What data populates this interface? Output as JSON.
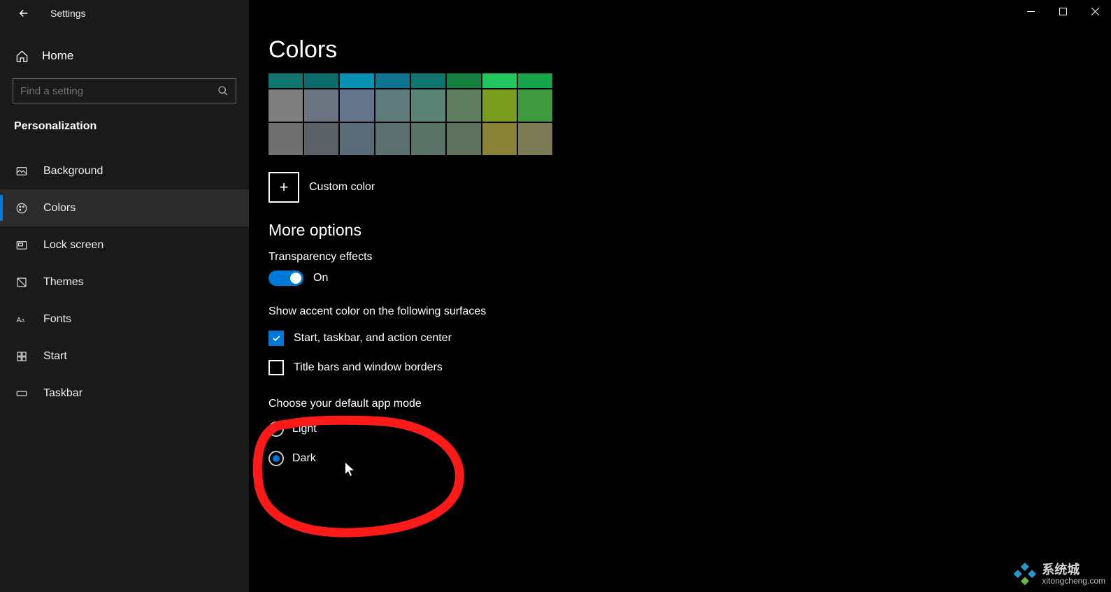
{
  "window": {
    "title": "Settings"
  },
  "sidebar": {
    "home": "Home",
    "search_placeholder": "Find a setting",
    "category": "Personalization",
    "items": [
      {
        "label": "Background"
      },
      {
        "label": "Colors"
      },
      {
        "label": "Lock screen"
      },
      {
        "label": "Themes"
      },
      {
        "label": "Fonts"
      },
      {
        "label": "Start"
      },
      {
        "label": "Taskbar"
      }
    ]
  },
  "main": {
    "title": "Colors",
    "swatch_rows": [
      [
        "#0f766e",
        "#0e6b6b",
        "#0891b2",
        "#0e7490",
        "#0f766e",
        "#15803d",
        "#22c55e",
        "#16a34a"
      ],
      [
        "#7f7f7f",
        "#6b7280",
        "#64748b",
        "#5f7a7a",
        "#5a8275",
        "#5f7d5f",
        "#7a9c1f",
        "#3f9a3f"
      ],
      [
        "#707070",
        "#5c6168",
        "#5a6b78",
        "#5c7070",
        "#5a7268",
        "#5f725f",
        "#8a8236",
        "#7a7a55"
      ]
    ],
    "custom_color": "Custom color",
    "more_options": "More options",
    "transparency_label": "Transparency effects",
    "transparency_state": "On",
    "accent_surfaces_label": "Show accent color on the following surfaces",
    "check_start": "Start, taskbar, and action center",
    "check_title": "Title bars and window borders",
    "app_mode_label": "Choose your default app mode",
    "mode_light": "Light",
    "mode_dark": "Dark"
  },
  "watermark": {
    "main": "系统城",
    "sub": "xitongcheng.com"
  }
}
